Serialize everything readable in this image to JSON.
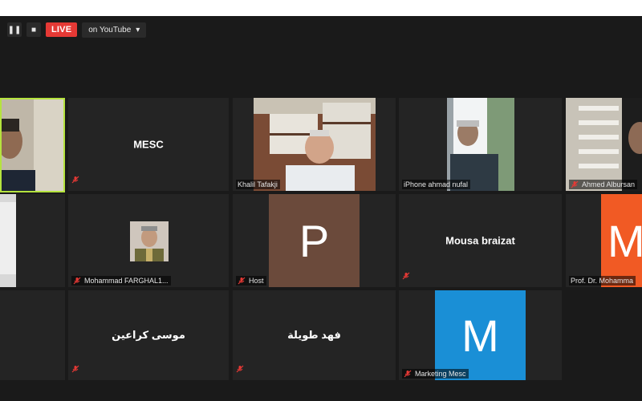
{
  "toolbar": {
    "pause_icon": "pause-icon",
    "stop_icon": "stop-icon",
    "live_label": "LIVE",
    "youtube_label": "on YouTube",
    "dropdown_icon": "chevron-down-icon"
  },
  "colors": {
    "background": "#1a1a1a",
    "tile": "#242424",
    "active_border": "#b5e33e",
    "live": "#e53935",
    "muted_icon": "#e53935",
    "avatar_p": "#6b4a3b",
    "avatar_m_blue": "#1a8fd6",
    "avatar_m_orange": "#f15a24"
  },
  "participants": [
    {
      "id": "speaker",
      "label": "",
      "muted": false
    },
    {
      "id": "mesc",
      "center_name": "MESC",
      "muted": true
    },
    {
      "id": "khalil",
      "label": "Khalil Tafakji",
      "muted": false
    },
    {
      "id": "iphone",
      "label": "iPhone ahmad nufal",
      "muted": false
    },
    {
      "id": "ahmed",
      "label": "Ahmed Albursan",
      "muted": true
    },
    {
      "id": "left-mid",
      "label": "",
      "muted": false
    },
    {
      "id": "mohammad",
      "label": "Mohammad FARGHAL1...",
      "muted": true
    },
    {
      "id": "host",
      "label": "Host",
      "avatar_letter": "P",
      "muted": true
    },
    {
      "id": "mousa",
      "center_name": "Mousa braizat",
      "muted": true
    },
    {
      "id": "prof",
      "label": "Prof. Dr. Mohamma",
      "avatar_letter": "M",
      "muted": false
    },
    {
      "id": "left-bottom",
      "label": "",
      "muted": false
    },
    {
      "id": "arabic1",
      "center_name": "موسى كراعين",
      "muted": true
    },
    {
      "id": "arabic2",
      "center_name": "فهد طويلة",
      "muted": true
    },
    {
      "id": "marketing",
      "label": "Marketing Mesc",
      "avatar_letter": "M",
      "muted": true
    }
  ]
}
